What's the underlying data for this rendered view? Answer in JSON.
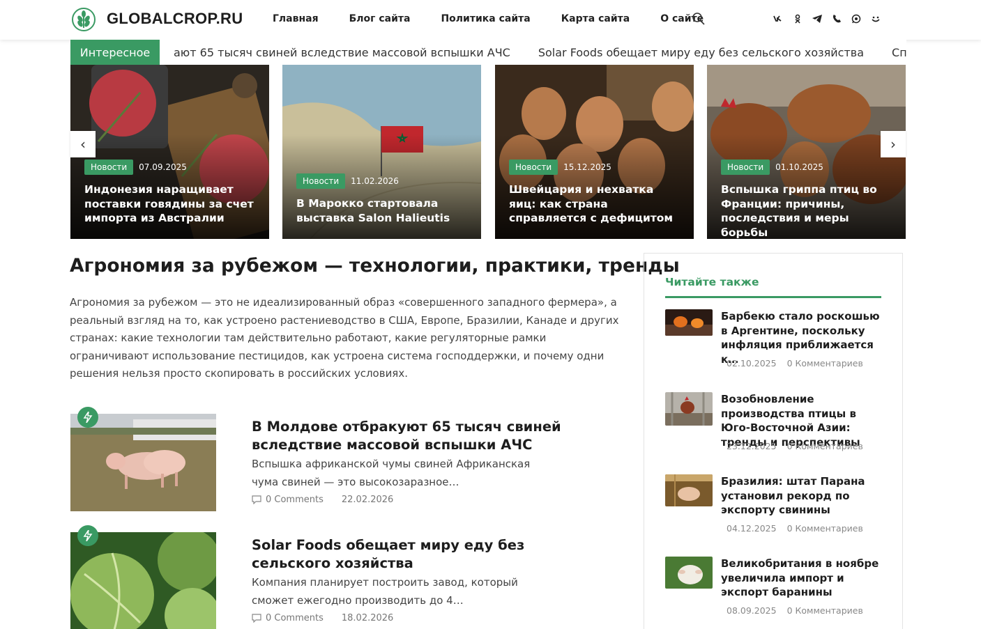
{
  "header": {
    "logo_text": "GLOBALCROP.RU",
    "nav": [
      "Главная",
      "Блог сайта",
      "Политика сайта",
      "Карта сайта",
      "О сайте"
    ],
    "socials": [
      "vk-icon",
      "odnoklassniki-icon",
      "telegram-icon",
      "viber-icon",
      "whatsapp-icon",
      "max-icon"
    ]
  },
  "ticker": {
    "label": "Интересное",
    "items": [
      "ают 65 тысяч свиней вследствие массовой вспышки АЧС",
      "Solar Foods обещает миру еду без сельского хозяйства",
      "Спрос на мясо птиц"
    ]
  },
  "slider": {
    "prev": "‹",
    "next": "›",
    "slides": [
      {
        "badge": "Новости",
        "date": "07.09.2025",
        "title": "Индонезия наращивает поставки говядины за счет импорта из Австралии"
      },
      {
        "badge": "Новости",
        "date": "11.02.2026",
        "title": "В Марокко стартовала выставка Salon Halieutis"
      },
      {
        "badge": "Новости",
        "date": "15.12.2025",
        "title": "Швейцария и нехватка яиц: как страна справляется с дефицитом"
      },
      {
        "badge": "Новости",
        "date": "01.10.2025",
        "title": "Вспышка гриппа птиц во Франции: причины, последствия и меры борьбы"
      }
    ]
  },
  "main": {
    "title": "Агрономия за рубежом — технологии, практики, тренды",
    "intro": "Агрономия за рубежом — это не идеализированный образ «совершенного западного фермера», а реальный взгляд на то, как устроено растениеводство в США, Европе, Бразилии, Канаде и других странах: какие технологии там действительно работают, какие регуляторные рамки ограничивают использование пестицидов, как устроена система господдержки, и почему одни решения нельзя просто скопировать в российских условиях.",
    "posts": [
      {
        "title": "В Молдове отбракуют 65 тысяч свиней вследствие массовой вспышки АЧС",
        "excerpt": "Вспышка африканской чумы свиней Африканская чума свиней — это высокозаразное…",
        "comments": "0 Comments",
        "date": "22.02.2026"
      },
      {
        "title": "Solar Foods обещает миру еду без сельского хозяйства",
        "excerpt": "Компания планирует построить завод, который сможет ежегодно производить до 4…",
        "comments": "0 Comments",
        "date": "18.02.2026"
      }
    ]
  },
  "sidebar": {
    "heading": "Читайте также",
    "items": [
      {
        "title": "Барбекю стало роскошью в Аргентине, поскольку инфляция приближается к…",
        "date": "02.10.2025",
        "comments": "0 Комментариев"
      },
      {
        "title": "Возобновление производства птицы в Юго-Восточной Азии: тренды и перспективы",
        "date": "23.12.2025",
        "comments": "0 Комментариев"
      },
      {
        "title": "Бразилия: штат Парана установил рекорд по экспорту свинины",
        "date": "04.12.2025",
        "comments": "0 Комментариев"
      },
      {
        "title": "Великобритания в ноябре увеличила импорт и экспорт баранины",
        "date": "08.09.2025",
        "comments": "0 Комментариев"
      }
    ]
  },
  "colors": {
    "accent": "#3a9a63"
  }
}
